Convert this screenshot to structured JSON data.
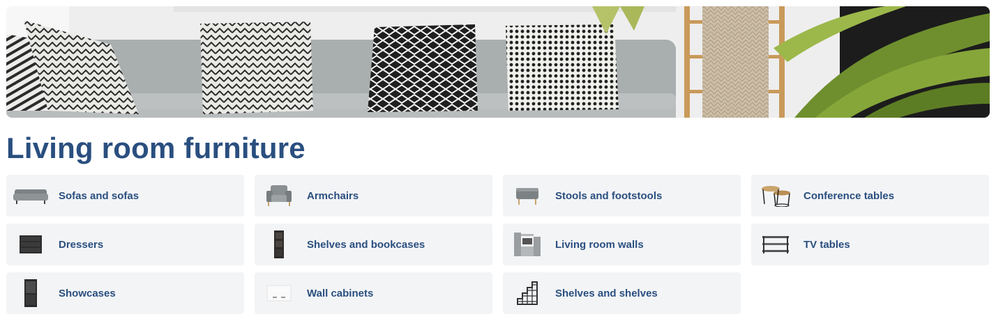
{
  "banner": {
    "alt": ""
  },
  "page_title": "Living room furniture",
  "categories": [
    {
      "label": "Sofas and sofas",
      "icon": "sofa-icon"
    },
    {
      "label": "Armchairs",
      "icon": "armchair-icon"
    },
    {
      "label": "Stools and footstools",
      "icon": "footstool-icon"
    },
    {
      "label": "Conference tables",
      "icon": "coffee-table-icon"
    },
    {
      "label": "Dressers",
      "icon": "dresser-icon"
    },
    {
      "label": "Shelves and bookcases",
      "icon": "bookcase-icon"
    },
    {
      "label": "Living room walls",
      "icon": "wall-unit-icon"
    },
    {
      "label": "TV tables",
      "icon": "tv-stand-icon"
    },
    {
      "label": "Showcases",
      "icon": "showcase-icon"
    },
    {
      "label": "Wall cabinets",
      "icon": "wall-cabinet-icon"
    },
    {
      "label": "Shelves and shelves",
      "icon": "stair-shelf-icon"
    }
  ],
  "colors": {
    "title": "#2a4f7f",
    "tile_bg": "#f3f4f6"
  }
}
